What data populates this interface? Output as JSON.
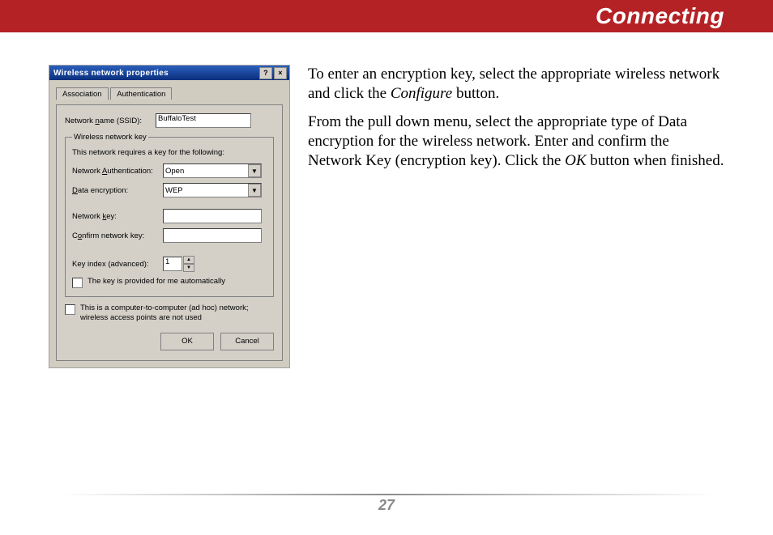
{
  "header": {
    "title": "Connecting"
  },
  "page_number": "27",
  "instructions": {
    "p1_a": "To enter an encryption key, select the appropriate wireless network and click the ",
    "p1_em": "Configure",
    "p1_b": " button.",
    "p2_a": "From the pull down menu, select the appropriate type of  Data encryption for the wireless network.  Enter and confirm the Network Key (encryption key).  Click the ",
    "p2_em": "OK",
    "p2_b": " button when finished."
  },
  "dialog": {
    "title": "Wireless network properties",
    "help_glyph": "?",
    "close_glyph": "×",
    "tabs": {
      "association": "Association",
      "authentication": "Authentication"
    },
    "ssid_label_pre": "Network ",
    "ssid_label_u": "n",
    "ssid_label_post": "ame (SSID):",
    "ssid_value": "BuffaloTest",
    "group_legend": "Wireless network key",
    "group_hint": "This network requires a key for the following:",
    "auth_label_pre": "Network ",
    "auth_label_u": "A",
    "auth_label_post": "uthentication:",
    "auth_value": "Open",
    "enc_label_u": "D",
    "enc_label_post": "ata encryption:",
    "enc_value": "WEP",
    "key_label_pre": "Network ",
    "key_label_u": "k",
    "key_label_post": "ey:",
    "key_value": "",
    "confirm_label_pre": "C",
    "confirm_label_u": "o",
    "confirm_label_post": "nfirm network key:",
    "confirm_value": "",
    "keyindex_label": "Key index (advanced):",
    "keyindex_value": "1",
    "auto_checkbox": "The key is provided for me automatically",
    "adhoc_checkbox": "This is a computer-to-computer (ad hoc) network; wireless access points are not used",
    "ok": "OK",
    "cancel": "Cancel"
  }
}
